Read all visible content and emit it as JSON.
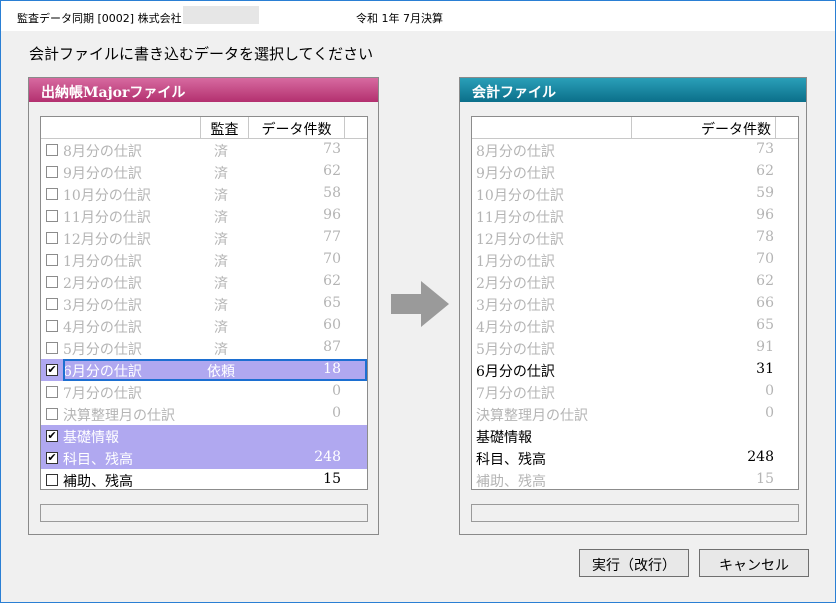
{
  "window": {
    "title_left": "監査データ同期 [0002] 株式会社",
    "title_center": "令和 1年 7月決算"
  },
  "instruction": "会計ファイルに書き込むデータを選択してください",
  "left_panel": {
    "header": "出納帳Majorファイル",
    "columns": {
      "audit": "監査",
      "count": "データ件数"
    },
    "rows": [
      {
        "name": " 8月分の仕訳",
        "audit": "済",
        "count": "73",
        "checked": false,
        "state": "disabled"
      },
      {
        "name": " 9月分の仕訳",
        "audit": "済",
        "count": "62",
        "checked": false,
        "state": "disabled"
      },
      {
        "name": "10月分の仕訳",
        "audit": "済",
        "count": "58",
        "checked": false,
        "state": "disabled"
      },
      {
        "name": "11月分の仕訳",
        "audit": "済",
        "count": "96",
        "checked": false,
        "state": "disabled"
      },
      {
        "name": "12月分の仕訳",
        "audit": "済",
        "count": "77",
        "checked": false,
        "state": "disabled"
      },
      {
        "name": " 1月分の仕訳",
        "audit": "済",
        "count": "70",
        "checked": false,
        "state": "disabled"
      },
      {
        "name": " 2月分の仕訳",
        "audit": "済",
        "count": "62",
        "checked": false,
        "state": "disabled"
      },
      {
        "name": " 3月分の仕訳",
        "audit": "済",
        "count": "65",
        "checked": false,
        "state": "disabled"
      },
      {
        "name": " 4月分の仕訳",
        "audit": "済",
        "count": "60",
        "checked": false,
        "state": "disabled"
      },
      {
        "name": " 5月分の仕訳",
        "audit": "済",
        "count": "87",
        "checked": false,
        "state": "disabled"
      },
      {
        "name": " 6月分の仕訳",
        "audit": "依頼",
        "count": "18",
        "checked": true,
        "state": "selected-focus"
      },
      {
        "name": " 7月分の仕訳",
        "audit": "",
        "count": "0",
        "checked": false,
        "state": "disabled"
      },
      {
        "name": "決算整理月の仕訳",
        "audit": "",
        "count": "0",
        "checked": false,
        "state": "disabled"
      },
      {
        "name": "基礎情報",
        "audit": "",
        "count": "",
        "checked": true,
        "state": "selected"
      },
      {
        "name": "科目、残高",
        "audit": "",
        "count": "248",
        "checked": true,
        "state": "selected"
      },
      {
        "name": "補助、残高",
        "audit": "",
        "count": "15",
        "checked": false,
        "state": "normal"
      }
    ],
    "checkmark": "✔"
  },
  "right_panel": {
    "header": "会計ファイル",
    "columns": {
      "count": "データ件数"
    },
    "rows": [
      {
        "name": " 8月分の仕訳",
        "count": "73",
        "state": "disabled"
      },
      {
        "name": " 9月分の仕訳",
        "count": "62",
        "state": "disabled"
      },
      {
        "name": "10月分の仕訳",
        "count": "59",
        "state": "disabled"
      },
      {
        "name": "11月分の仕訳",
        "count": "96",
        "state": "disabled"
      },
      {
        "name": "12月分の仕訳",
        "count": "78",
        "state": "disabled"
      },
      {
        "name": " 1月分の仕訳",
        "count": "70",
        "state": "disabled"
      },
      {
        "name": " 2月分の仕訳",
        "count": "62",
        "state": "disabled"
      },
      {
        "name": " 3月分の仕訳",
        "count": "66",
        "state": "disabled"
      },
      {
        "name": " 4月分の仕訳",
        "count": "65",
        "state": "disabled"
      },
      {
        "name": " 5月分の仕訳",
        "count": "91",
        "state": "disabled"
      },
      {
        "name": " 6月分の仕訳",
        "count": "31",
        "state": "normal"
      },
      {
        "name": " 7月分の仕訳",
        "count": "0",
        "state": "disabled"
      },
      {
        "name": "決算整理月の仕訳",
        "count": "0",
        "state": "disabled"
      },
      {
        "name": "基礎情報",
        "count": "",
        "state": "normal"
      },
      {
        "name": "科目、残高",
        "count": "248",
        "state": "normal"
      },
      {
        "name": "補助、残高",
        "count": "15",
        "state": "disabled"
      }
    ]
  },
  "buttons": {
    "execute": "実行（改行）",
    "cancel": "キャンセル"
  },
  "colors": {
    "left_header": "#b3306f",
    "right_header": "#0b6f8a",
    "selection": "#b0a8f0",
    "focus_border": "#1c6fd1",
    "arrow": "#9a9a9a"
  }
}
